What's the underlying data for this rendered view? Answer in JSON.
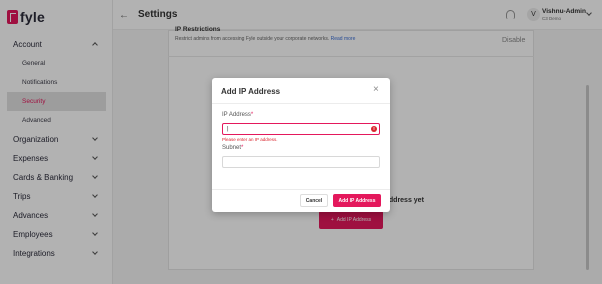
{
  "app": {
    "logo_text": "fyle"
  },
  "sidebar": {
    "account": {
      "label": "Account"
    },
    "account_items": [
      {
        "label": "General"
      },
      {
        "label": "Notifications"
      },
      {
        "label": "Security"
      },
      {
        "label": "Advanced"
      }
    ],
    "sections": [
      {
        "label": "Organization"
      },
      {
        "label": "Expenses"
      },
      {
        "label": "Cards & Banking"
      },
      {
        "label": "Trips"
      },
      {
        "label": "Advances"
      },
      {
        "label": "Employees"
      },
      {
        "label": "Integrations"
      }
    ]
  },
  "header": {
    "back_icon": "arrow-left-icon",
    "title": "Settings",
    "user": {
      "avatar_initial": "V",
      "name": "Vishnu-Admin",
      "org": "C3 Demo"
    }
  },
  "main": {
    "section_title": "IP Restrictions",
    "description": "Restrict admins from accessing Fyle outside your corporate networks.",
    "read_more": "Read more",
    "disable_label": "Disable",
    "empty_text": "address yet",
    "add_ip_button": "Add IP Address",
    "add_icon": "plus-icon"
  },
  "modal": {
    "title": "Add IP Address",
    "close_icon": "close-icon",
    "ip_label": "IP Address",
    "ip_value": "|",
    "ip_placeholder": "",
    "ip_error": "Please enter an IP address.",
    "subnet_label": "Subnet",
    "subnet_value": "",
    "required_marker": "*",
    "cancel_label": "Cancel",
    "add_label": "Add IP Address"
  },
  "colors": {
    "brand": "#e4185c",
    "error": "#d9262e",
    "link": "#3b6fd6"
  }
}
